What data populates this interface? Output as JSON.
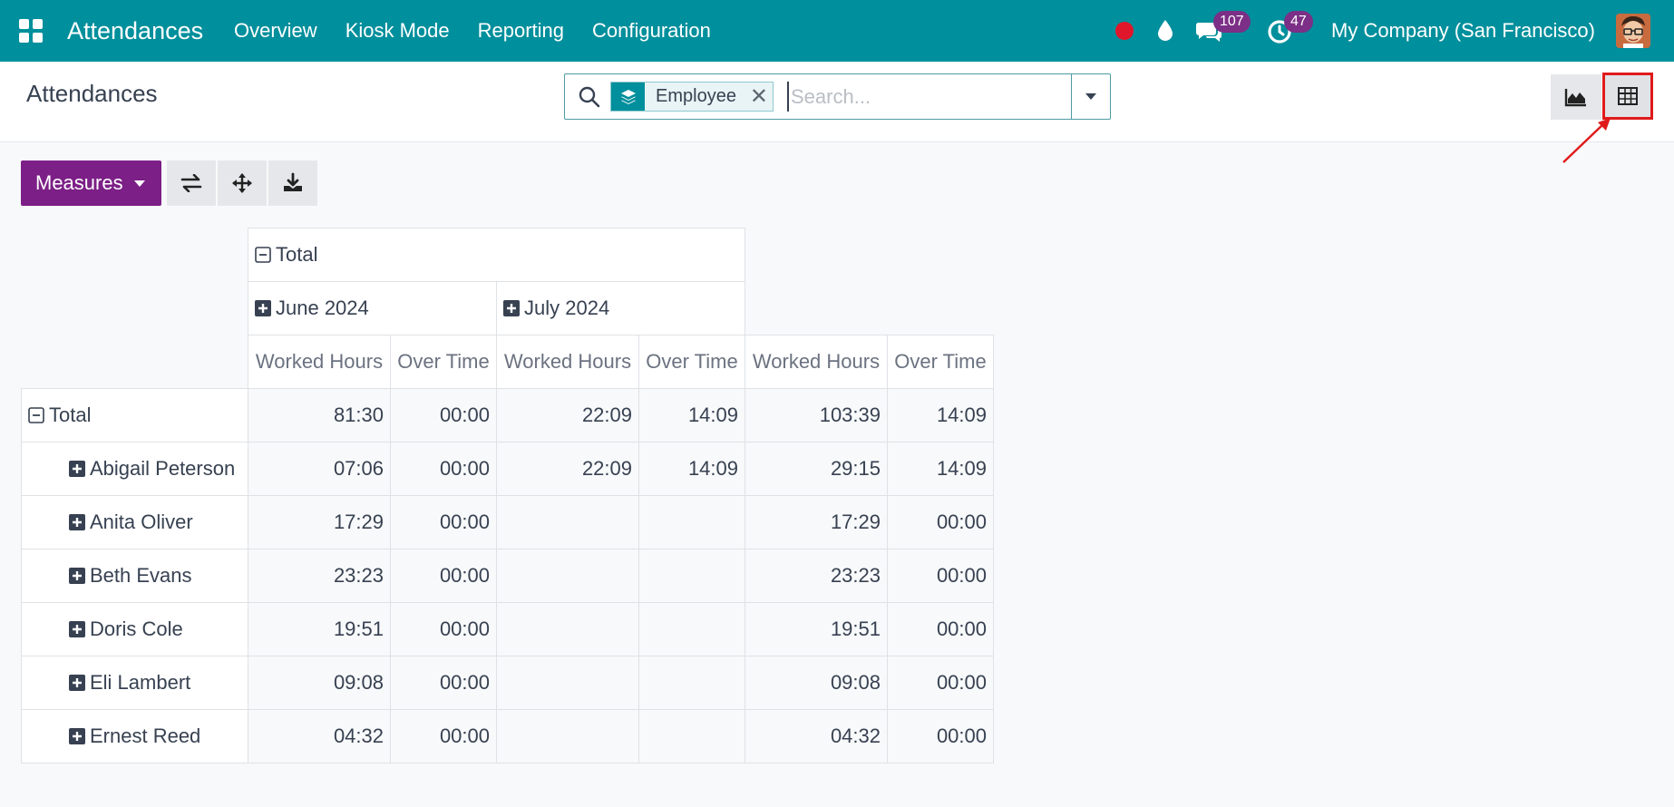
{
  "navbar": {
    "app_title": "Attendances",
    "menu": [
      "Overview",
      "Kiosk Mode",
      "Reporting",
      "Configuration"
    ],
    "messages_count": "107",
    "activities_count": "47",
    "company": "My Company (San Francisco)"
  },
  "control_panel": {
    "breadcrumb": "Attendances",
    "search": {
      "facet_label": "Employee",
      "placeholder": "Search..."
    }
  },
  "pivot": {
    "measures_label": "Measures",
    "col_total_label": "Total",
    "col_groups": [
      "June 2024",
      "July 2024"
    ],
    "measure_headers": [
      "Worked Hours",
      "Over Time",
      "Worked Hours",
      "Over Time",
      "Worked Hours",
      "Over Time"
    ],
    "rows": [
      {
        "label": "Total",
        "values": [
          "81:30",
          "00:00",
          "22:09",
          "14:09",
          "103:39",
          "14:09"
        ]
      },
      {
        "label": "Abigail Peterson",
        "values": [
          "07:06",
          "00:00",
          "22:09",
          "14:09",
          "29:15",
          "14:09"
        ]
      },
      {
        "label": "Anita Oliver",
        "values": [
          "17:29",
          "00:00",
          "",
          "",
          "17:29",
          "00:00"
        ]
      },
      {
        "label": "Beth Evans",
        "values": [
          "23:23",
          "00:00",
          "",
          "",
          "23:23",
          "00:00"
        ]
      },
      {
        "label": "Doris Cole",
        "values": [
          "19:51",
          "00:00",
          "",
          "",
          "19:51",
          "00:00"
        ]
      },
      {
        "label": "Eli Lambert",
        "values": [
          "09:08",
          "00:00",
          "",
          "",
          "09:08",
          "00:00"
        ]
      },
      {
        "label": "Ernest Reed",
        "values": [
          "04:32",
          "00:00",
          "",
          "",
          "04:32",
          "00:00"
        ]
      }
    ]
  },
  "colors": {
    "navbar": "#008f9c",
    "primary_button": "#7c1f86",
    "highlight": "#e01a1a"
  }
}
